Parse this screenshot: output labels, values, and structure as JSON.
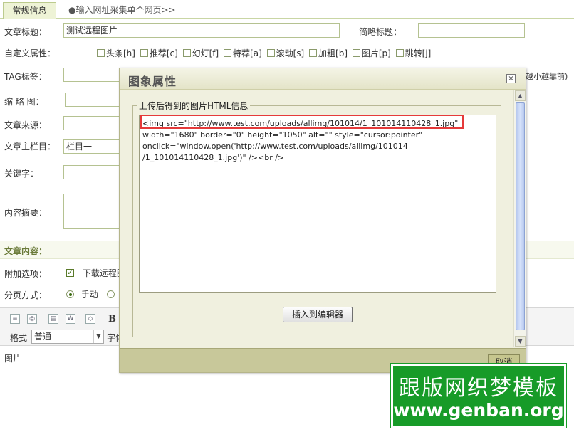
{
  "tabs": [
    {
      "label": "常规信息",
      "active": true
    },
    {
      "label": "●输入网址采集单个网页>>",
      "active": false
    }
  ],
  "form": {
    "title_label": "文章标题：",
    "title_value": "测试远程图片",
    "short_title_label": "简略标题：",
    "custom_attr_label": "自定义属性：",
    "attrs": [
      "头条[h]",
      "推荐[c]",
      "幻灯[f]",
      "特荐[a]",
      "滚动[s]",
      "加粗[b]",
      "图片[p]",
      "跳转[j]"
    ],
    "tag_label": "TAG标签：",
    "tag_hint_fragment": "越小越靠前)",
    "thumb_label": "缩 略 图：",
    "source_label": "文章来源：",
    "category_label": "文章主栏目：",
    "category_value": "栏目一",
    "keywords_label": "关键字：",
    "summary_label": "内容摘要："
  },
  "content_section": {
    "title": "文章内容：",
    "extra_label": "附加选项：",
    "extra_option": "下载远程图",
    "page_label": "分页方式：",
    "page_option_manual": "手动"
  },
  "editor": {
    "format_label": "格式",
    "format_value": "普通",
    "font_label": "字体",
    "toolbar_icons": [
      "source-icon",
      "preview-icon",
      "paste-icon",
      "paste-word-icon",
      "eraser-icon",
      "bold-icon"
    ],
    "bold_glyph": "B",
    "content": "图片"
  },
  "dialog": {
    "title": "图象属性",
    "close_glyph": "×",
    "legend": "上传后得到的图片HTML信息",
    "code_lines": [
      "<img src=\"http://www.test.com/uploads/allimg/101014/1_101014110428_1.jpg\"",
      "width=\"1680\" border=\"0\" height=\"1050\" alt=\"\" style=\"cursor:pointer\"",
      "onclick=\"window.open('http://www.test.com/uploads/allimg/101014",
      "/1_101014110428_1.jpg')\" /><br />"
    ],
    "insert_button": "插入到编辑器",
    "cancel_button": "取消",
    "scroll_up": "▲",
    "scroll_down": "▼"
  },
  "watermark": {
    "line1": "跟版网织梦模板",
    "line2": "www.genban.org"
  },
  "colors": {
    "accent_green": "#179b28",
    "highlight_red": "#e53a3a",
    "section_title": "#6b7b3a",
    "dialog_bg": "#f0f0df"
  }
}
